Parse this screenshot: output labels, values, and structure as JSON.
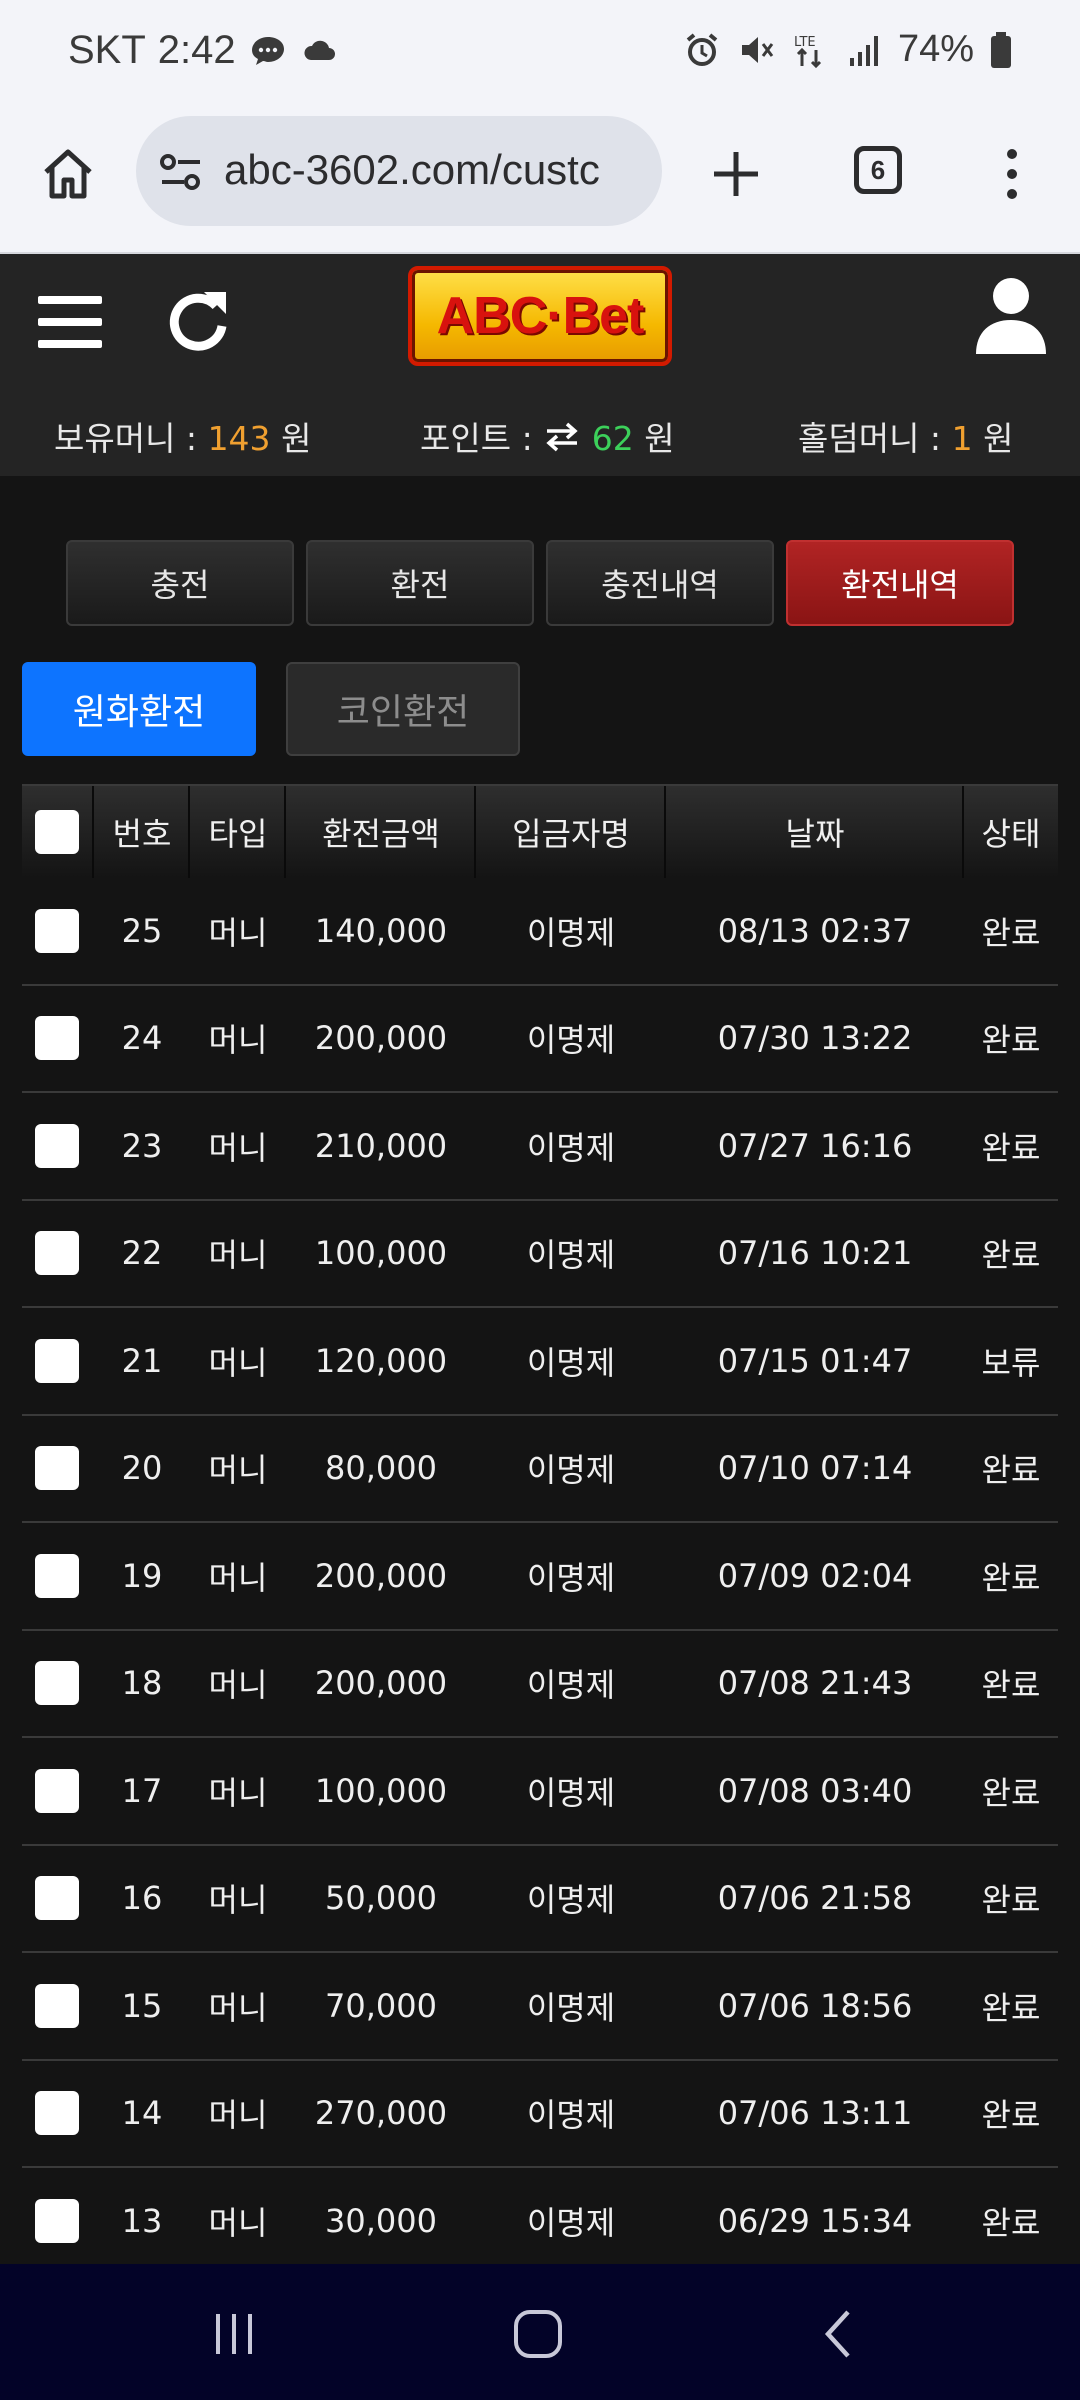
{
  "status_bar": {
    "carrier": "SKT",
    "time": "2:42",
    "battery": "74%",
    "icons": [
      "chat-bubble-icon",
      "cloud-icon",
      "alarm-icon",
      "mute-icon",
      "lte-icon",
      "signal-icon",
      "battery-icon"
    ]
  },
  "browser": {
    "url": "abc-3602.com/custc",
    "tab_count": "6"
  },
  "site": {
    "logo": "ABC·Bet",
    "balances": {
      "money_label": "보유머니 :",
      "money_value": "143",
      "points_label": "포인트 :",
      "points_value": "62",
      "holdem_label": "홀덤머니 :",
      "holdem_value": "1",
      "unit": "원"
    },
    "colors": {
      "accent_orange": "#f0a030",
      "accent_green": "#3cd05a",
      "active_red": "#b12424",
      "active_blue": "#0d74ff"
    }
  },
  "menu": {
    "charge": "충전",
    "exchange": "환전",
    "charge_history": "충전내역",
    "exchange_history": "환전내역"
  },
  "subtabs": {
    "fiat": "원화환전",
    "coin": "코인환전"
  },
  "table": {
    "headers": [
      "번호",
      "타입",
      "환전금액",
      "입금자명",
      "날짜",
      "상태"
    ],
    "rows": [
      {
        "no": "25",
        "type": "머니",
        "amount": "140,000",
        "name": "이명제",
        "date": "08/13 02:37",
        "status": "완료"
      },
      {
        "no": "24",
        "type": "머니",
        "amount": "200,000",
        "name": "이명제",
        "date": "07/30 13:22",
        "status": "완료"
      },
      {
        "no": "23",
        "type": "머니",
        "amount": "210,000",
        "name": "이명제",
        "date": "07/27 16:16",
        "status": "완료"
      },
      {
        "no": "22",
        "type": "머니",
        "amount": "100,000",
        "name": "이명제",
        "date": "07/16 10:21",
        "status": "완료"
      },
      {
        "no": "21",
        "type": "머니",
        "amount": "120,000",
        "name": "이명제",
        "date": "07/15 01:47",
        "status": "보류"
      },
      {
        "no": "20",
        "type": "머니",
        "amount": "80,000",
        "name": "이명제",
        "date": "07/10 07:14",
        "status": "완료"
      },
      {
        "no": "19",
        "type": "머니",
        "amount": "200,000",
        "name": "이명제",
        "date": "07/09 02:04",
        "status": "완료"
      },
      {
        "no": "18",
        "type": "머니",
        "amount": "200,000",
        "name": "이명제",
        "date": "07/08 21:43",
        "status": "완료"
      },
      {
        "no": "17",
        "type": "머니",
        "amount": "100,000",
        "name": "이명제",
        "date": "07/08 03:40",
        "status": "완료"
      },
      {
        "no": "16",
        "type": "머니",
        "amount": "50,000",
        "name": "이명제",
        "date": "07/06 21:58",
        "status": "완료"
      },
      {
        "no": "15",
        "type": "머니",
        "amount": "70,000",
        "name": "이명제",
        "date": "07/06 18:56",
        "status": "완료"
      },
      {
        "no": "14",
        "type": "머니",
        "amount": "270,000",
        "name": "이명제",
        "date": "07/06 13:11",
        "status": "완료"
      },
      {
        "no": "13",
        "type": "머니",
        "amount": "30,000",
        "name": "이명제",
        "date": "06/29 15:34",
        "status": "완료"
      }
    ]
  }
}
